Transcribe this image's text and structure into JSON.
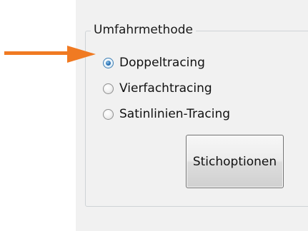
{
  "group": {
    "title": "Umfahrmethode"
  },
  "options": [
    {
      "label": "Doppeltracing",
      "selected": true
    },
    {
      "label": "Vierfachtracing",
      "selected": false
    },
    {
      "label": "Satinlinien-Tracing",
      "selected": false
    }
  ],
  "button": {
    "label": "Stichoptionen"
  },
  "colors": {
    "arrow": "#f07a22",
    "panel": "#f1f1f1"
  },
  "icons": {
    "annotation": "arrow-right-icon"
  }
}
